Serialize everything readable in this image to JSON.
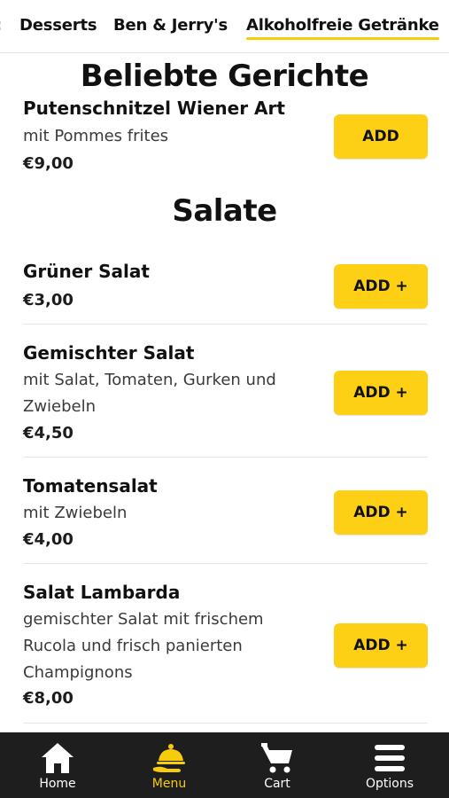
{
  "tabs": {
    "partial": ":",
    "items": [
      "Desserts",
      "Ben & Jerry's",
      "Alkoholfreie Getränke"
    ],
    "active_index": 2
  },
  "popular": {
    "heading": "Beliebte Gerichte",
    "item": {
      "name": "Putenschnitzel Wiener Art",
      "description": "mit Pommes frites",
      "price": "€9,00",
      "button": "ADD"
    }
  },
  "salads": {
    "heading": "Salate",
    "items": [
      {
        "name": "Grüner Salat",
        "desc_lines": [],
        "price": "€3,00",
        "button": "ADD +"
      },
      {
        "name": "Gemischter Salat",
        "desc_lines": [
          "mit Salat, Tomaten, Gurken und",
          "Zwiebeln"
        ],
        "price": "€4,50",
        "button": "ADD +"
      },
      {
        "name": "Tomatensalat",
        "desc_lines": [
          "mit Zwiebeln"
        ],
        "price": "€4,00",
        "button": "ADD +"
      },
      {
        "name": "Salat Lambarda",
        "desc_lines": [
          "gemischter Salat mit frischem",
          "Rucola und frisch panierten",
          "Champignons"
        ],
        "price": "€8,00",
        "button": "ADD +"
      }
    ]
  },
  "bottom_nav": {
    "items": [
      {
        "label": "Home",
        "icon": "home-icon"
      },
      {
        "label": "Menu",
        "icon": "menu-cloche-icon"
      },
      {
        "label": "Cart",
        "icon": "cart-icon"
      },
      {
        "label": "Options",
        "icon": "hamburger-menu-icon"
      }
    ],
    "active_index": 1
  },
  "colors": {
    "accent": "#fdd016",
    "nav_bg": "#1e1e1e",
    "active_nav": "#f7cc0a"
  }
}
